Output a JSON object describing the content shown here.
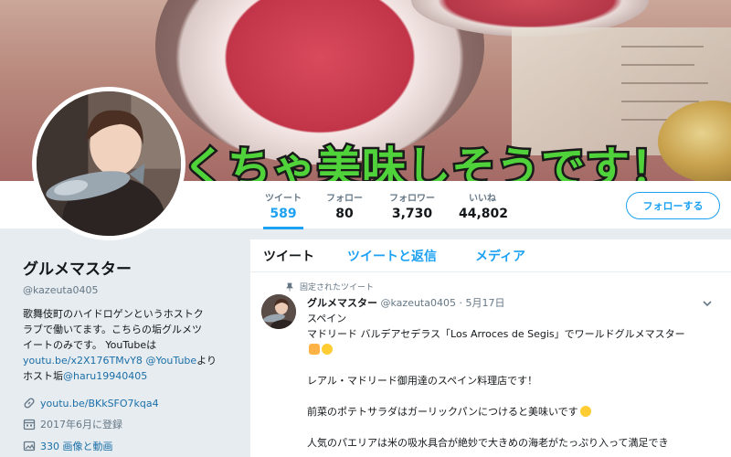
{
  "banner": {
    "caption": "くちゃ美味しそうです！"
  },
  "profile_nav": {
    "stats": [
      {
        "label": "ツイート",
        "value": "589"
      },
      {
        "label": "フォロー",
        "value": "80"
      },
      {
        "label": "フォロワー",
        "value": "3,730"
      },
      {
        "label": "いいね",
        "value": "44,802"
      }
    ],
    "follow_button": "フォローする"
  },
  "profile": {
    "name": "グルメマスター",
    "handle": "@kazeuta0405",
    "bio_line1": "歌舞伎町のハイドロゲンというホストク",
    "bio_line2": "ラブで働いてます。こちらの垢グルメツ",
    "bio_line3": "イートのみです。 YouTubeは",
    "bio_link1": "youtu.be/x2X176TMvY8",
    "bio_link2": "@YouTube",
    "bio_text_yori": "より",
    "bio_text_host": "ホスト垢",
    "bio_link3": "@haru19940405",
    "website": "youtu.be/BKkSFO7kqa4",
    "joined": "2017年6月に登録",
    "media": "330 画像と動画"
  },
  "timeline": {
    "tabs": [
      "ツイート",
      "ツイートと返信",
      "メディア"
    ],
    "pinned_label": "固定されたツイート",
    "tweet": {
      "name": "グルメマスター",
      "handle": "@kazeuta0405",
      "date": "· 5月17日",
      "line1": "スペイン",
      "line2": "マドリード バルデアセデラス「Los Arroces de Segis」でワールドグルメマスター",
      "line3": "レアル・マドリード御用達のスペイン料理店です！",
      "line4": "前菜のポテトサラダはガーリックパンにつけると美味いです",
      "line5": "人気のパエリアは米の吸水具合が絶妙で大きめの海老がたっぷり入って満足でき"
    }
  },
  "colors": {
    "accent": "#1da1f2",
    "link": "#1b6fa8",
    "caption": "#4fd23a"
  },
  "icons": [
    "pin-icon",
    "link-icon",
    "calendar-icon",
    "image-icon",
    "chevron-down-icon"
  ]
}
